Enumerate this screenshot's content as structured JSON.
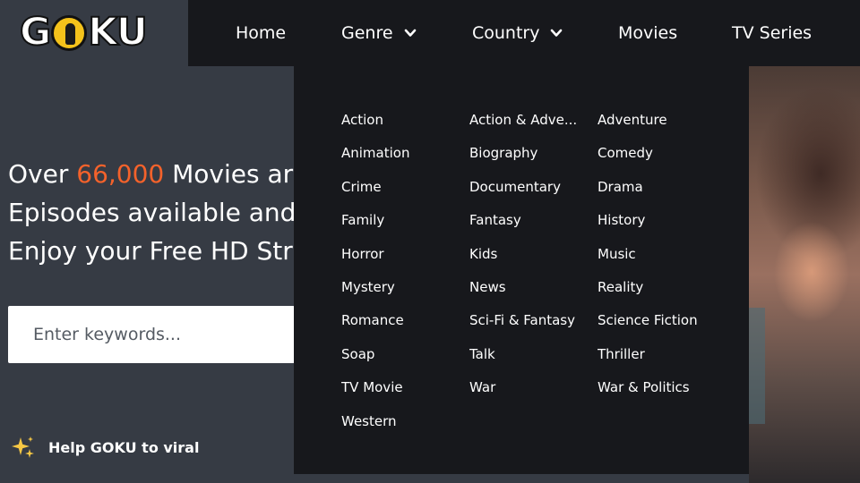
{
  "brand": {
    "logo_text_left": "G",
    "logo_text_right": "KU",
    "logo_full": "GOKU"
  },
  "nav": {
    "items": [
      {
        "label": "Home",
        "has_dropdown": false
      },
      {
        "label": "Genre",
        "has_dropdown": true
      },
      {
        "label": "Country",
        "has_dropdown": true
      },
      {
        "label": "Movies",
        "has_dropdown": false
      },
      {
        "label": "TV Series",
        "has_dropdown": false
      }
    ]
  },
  "hero": {
    "line1_pre": "Over ",
    "line1_accent": "66,000",
    "line1_post": " Movies ar",
    "line2": "Episodes available and",
    "line3": "Enjoy your Free HD Str",
    "accent_color": "#f4622b"
  },
  "search": {
    "placeholder": "Enter keywords..."
  },
  "help": {
    "label": "Help GOKU to viral",
    "icon": "sparkles-icon"
  },
  "genre_menu": {
    "items": [
      "Action",
      "Action & Adve...",
      "Adventure",
      "Animation",
      "Biography",
      "Comedy",
      "Crime",
      "Documentary",
      "Drama",
      "Family",
      "Fantasy",
      "History",
      "Horror",
      "Kids",
      "Music",
      "Mystery",
      "News",
      "Reality",
      "Romance",
      "Sci-Fi & Fantasy",
      "Science Fiction",
      "Soap",
      "Talk",
      "Thriller",
      "TV Movie",
      "War",
      "War & Politics",
      "Western"
    ]
  },
  "colors": {
    "page_bg": "#363b44",
    "nav_bg": "#17181c",
    "logo_yellow": "#f4c21b",
    "accent_orange": "#f4622b"
  }
}
